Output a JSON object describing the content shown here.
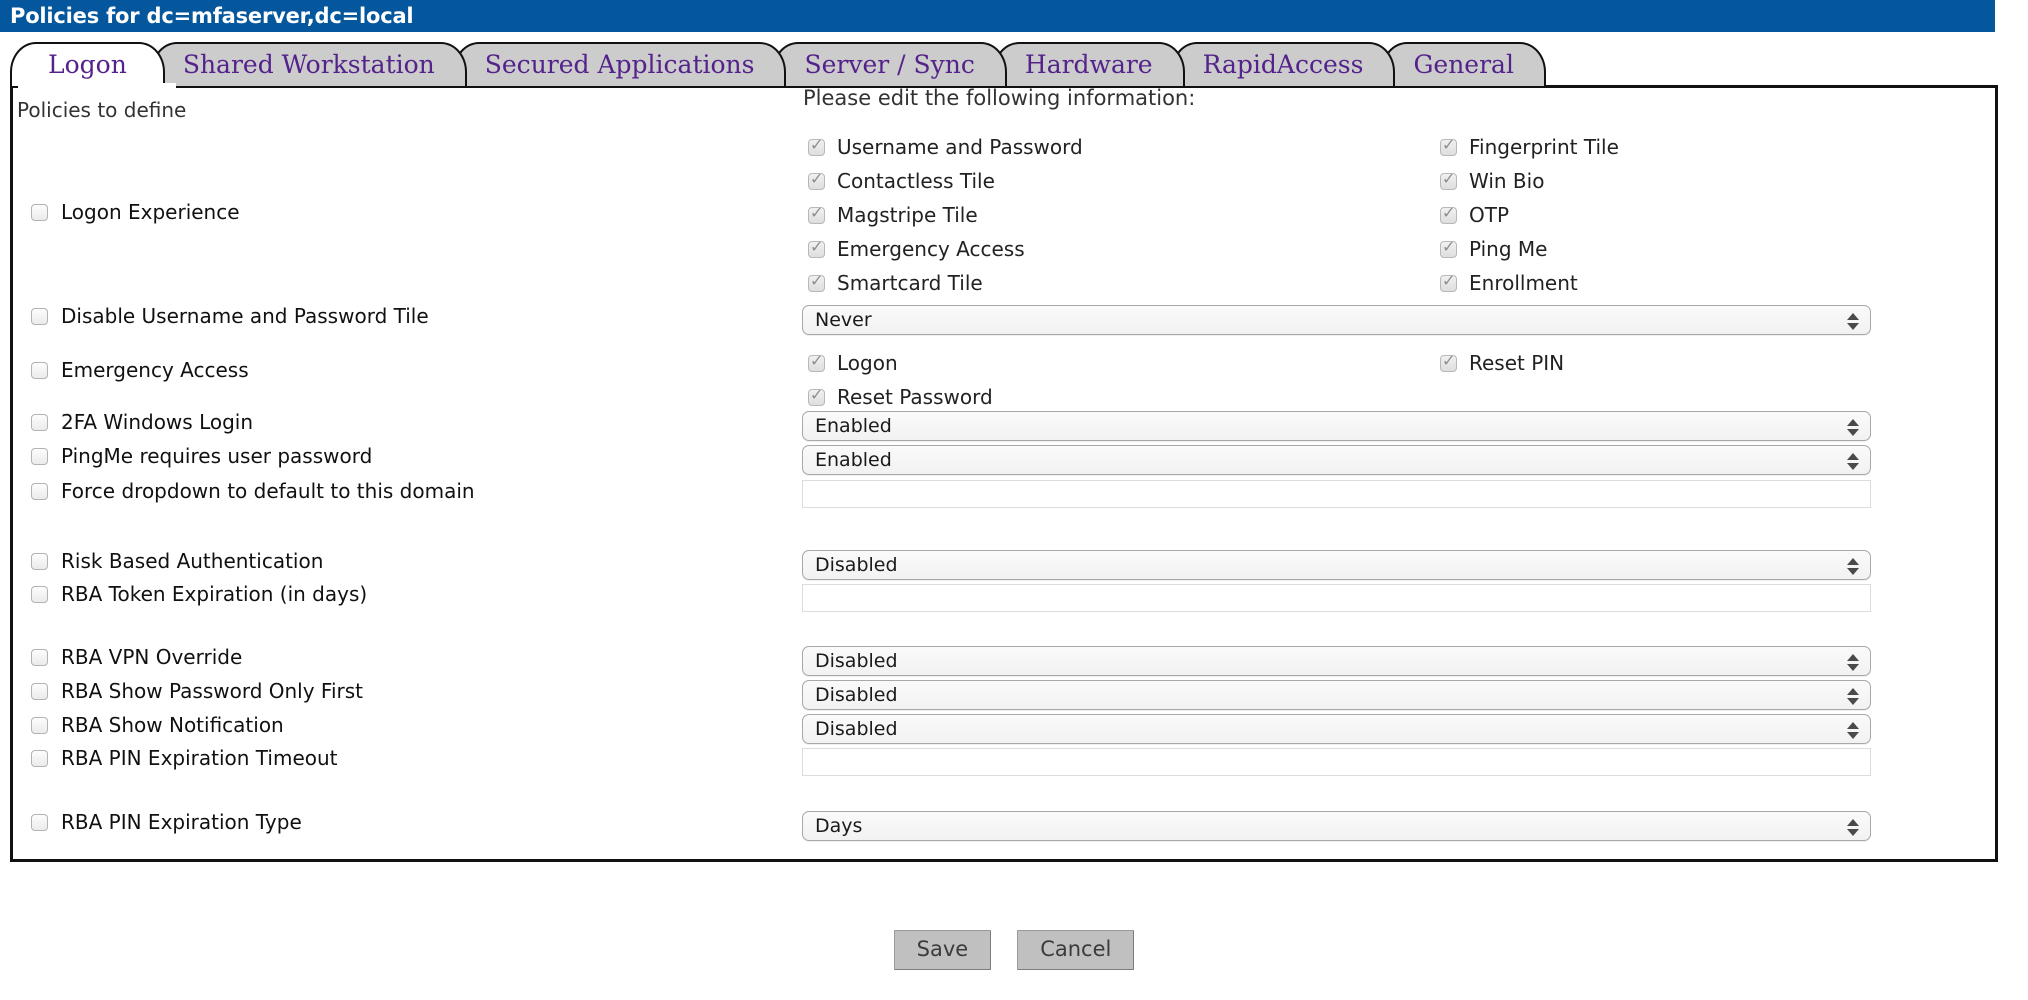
{
  "window": {
    "title": "Policies for dc=mfaserver,dc=local",
    "title_bar_color": "#04579d"
  },
  "tabs": [
    {
      "label": "Logon",
      "active": true
    },
    {
      "label": "Shared Workstation",
      "active": false
    },
    {
      "label": "Secured Applications",
      "active": false
    },
    {
      "label": "Server / Sync",
      "active": false
    },
    {
      "label": "Hardware",
      "active": false
    },
    {
      "label": "RapidAccess",
      "active": false
    },
    {
      "label": "General",
      "active": false
    }
  ],
  "tab_text_color": "#54228b",
  "headings": {
    "left": "Policies to define",
    "right": "Please edit the following information:"
  },
  "policies": [
    {
      "label": "Logon Experience",
      "checked": false
    },
    {
      "label": "Disable Username and Password Tile",
      "checked": false
    },
    {
      "label": "Emergency Access",
      "checked": false
    },
    {
      "label": "2FA Windows Login",
      "checked": false
    },
    {
      "label": "PingMe requires user password",
      "checked": false
    },
    {
      "label": "Force dropdown to default to this domain",
      "checked": false
    },
    {
      "label": "Risk Based Authentication",
      "checked": false
    },
    {
      "label": "RBA Token Expiration (in days)",
      "checked": false
    },
    {
      "label": "RBA VPN Override",
      "checked": false
    },
    {
      "label": "RBA Show Password Only First",
      "checked": false
    },
    {
      "label": "RBA Show Notification",
      "checked": false
    },
    {
      "label": "RBA PIN Expiration Timeout",
      "checked": false
    },
    {
      "label": "RBA PIN Expiration Type",
      "checked": false
    }
  ],
  "logon_experience_options": {
    "left_column": [
      {
        "label": "Username and Password",
        "checked": true
      },
      {
        "label": "Contactless Tile",
        "checked": true
      },
      {
        "label": "Magstripe Tile",
        "checked": true
      },
      {
        "label": "Emergency Access",
        "checked": true
      },
      {
        "label": "Smartcard Tile",
        "checked": true
      }
    ],
    "right_column": [
      {
        "label": "Fingerprint Tile",
        "checked": true
      },
      {
        "label": "Win Bio",
        "checked": true
      },
      {
        "label": "OTP",
        "checked": true
      },
      {
        "label": "Ping Me",
        "checked": true
      },
      {
        "label": "Enrollment",
        "checked": true
      }
    ]
  },
  "emergency_access_options": {
    "left_column": [
      {
        "label": "Logon",
        "checked": true
      },
      {
        "label": "Reset Password",
        "checked": true
      }
    ],
    "right_column": [
      {
        "label": "Reset PIN",
        "checked": true
      }
    ]
  },
  "fields": {
    "disable_username_password_tile": {
      "type": "select",
      "value": "Never"
    },
    "twofa_windows_login": {
      "type": "select",
      "value": "Enabled"
    },
    "pingme_requires_user_password": {
      "type": "select",
      "value": "Enabled"
    },
    "force_dropdown_domain": {
      "type": "text",
      "value": ""
    },
    "risk_based_authentication": {
      "type": "select",
      "value": "Disabled"
    },
    "rba_token_expiration": {
      "type": "text",
      "value": ""
    },
    "rba_vpn_override": {
      "type": "select",
      "value": "Disabled"
    },
    "rba_show_password_only_first": {
      "type": "select",
      "value": "Disabled"
    },
    "rba_show_notification": {
      "type": "select",
      "value": "Disabled"
    },
    "rba_pin_expiration_timeout": {
      "type": "text",
      "value": ""
    },
    "rba_pin_expiration_type": {
      "type": "select",
      "value": "Days"
    }
  },
  "footer": {
    "save_label": "Save",
    "cancel_label": "Cancel"
  }
}
